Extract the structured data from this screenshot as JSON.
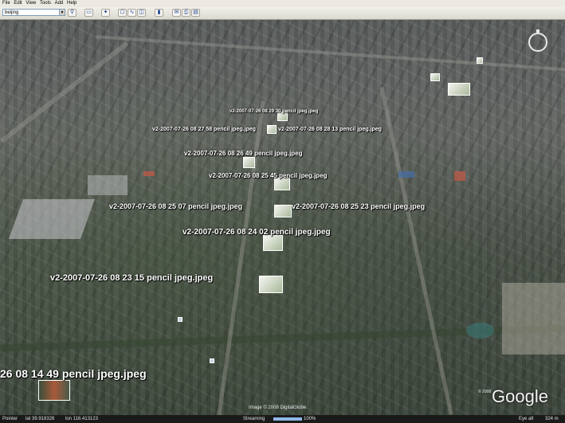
{
  "menu": [
    "File",
    "Edit",
    "View",
    "Tools",
    "Add",
    "Help"
  ],
  "search": {
    "value": "beijing"
  },
  "toolbar_icons": [
    "search-go-icon",
    "sidebar-icon",
    "placemark-icon",
    "polygon-icon",
    "path-icon",
    "overlay-icon",
    "ruler-icon",
    "email-icon",
    "print-icon",
    "maps-icon"
  ],
  "photo_labels": [
    {
      "text": "v2-2007-07-26 08 29 30 pencil jpeg.jpeg"
    },
    {
      "text": "v2-2007-07-26 08 27 58 pencil jpeg.jpeg"
    },
    {
      "text": "v2-2007-07-26 08 28 13 pencil jpeg.jpeg"
    },
    {
      "text": "v2-2007-07-26 08 26 49 pencil jpeg.jpeg"
    },
    {
      "text": "v2-2007-07-26 08 25 45 pencil jpeg.jpeg"
    },
    {
      "text": "v2-2007-07-26 08 25 07 pencil jpeg.jpeg"
    },
    {
      "text": "v2-2007-07-26 08 25 23 pencil jpeg.jpeg"
    },
    {
      "text": "v2-2007-07-26 08 24 02 pencil jpeg.jpeg"
    },
    {
      "text": "v2-2007-07-26 08 23 15 pencil jpeg.jpeg"
    },
    {
      "text": "26 08 14 49 pencil jpeg.jpeg"
    }
  ],
  "attribution": {
    "imagery": "Image © 2008 DigitalGlobe",
    "copyright": "© 2008",
    "logo": "Google"
  },
  "status": {
    "pointer": "Pointer",
    "lat": "lat  39.918328",
    "lon": "lon  116.413123",
    "streaming": "Streaming",
    "stream_pct": "100%",
    "stream_level": 1.0,
    "eye_alt_label": "Eye alt",
    "eye_alt": "324 m"
  }
}
